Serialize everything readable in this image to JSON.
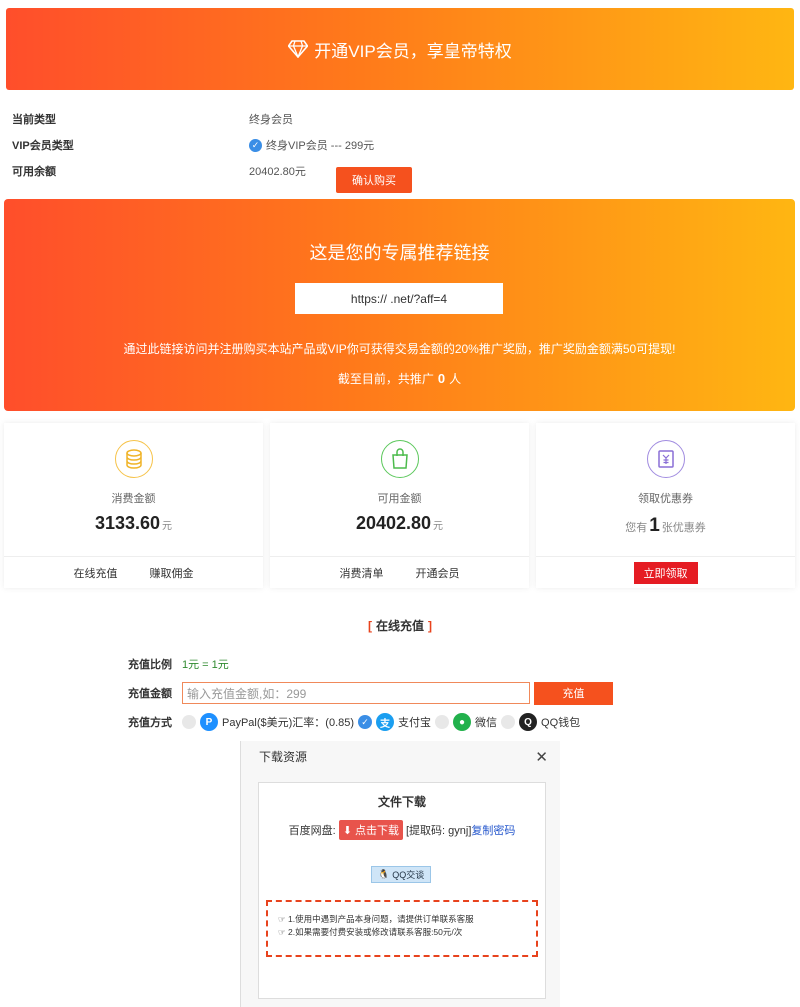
{
  "banner": {
    "title": "开通VIP会员，享皇帝特权"
  },
  "account": {
    "type_label": "当前类型",
    "type_value": "终身会员",
    "vip_label": "VIP会员类型",
    "vip_value": "终身VIP会员 --- 299元",
    "balance_label": "可用余额",
    "balance_value": "20402.80元",
    "buy_label": "确认购买"
  },
  "affiliate": {
    "title": "这是您的专属推荐链接",
    "link": "https://          .net/?aff=4",
    "desc": "通过此链接访问并注册购买本站产品或VIP你可获得交易金额的20%推广奖励，推广奖励金额满50可提现!",
    "count_prefix": "截至目前，共推广",
    "count": "0",
    "count_suffix": "人"
  },
  "cards": {
    "spent": {
      "label": "消费金额",
      "amount": "3133.60",
      "unit": "元",
      "action1": "在线充值",
      "action2": "赚取佣金"
    },
    "available": {
      "label": "可用金额",
      "amount": "20402.80",
      "unit": "元",
      "action1": "消费清单",
      "action2": "开通会员"
    },
    "coupon": {
      "label": "领取优惠券",
      "prefix": "您有",
      "count": "1",
      "suffix": "张优惠券",
      "action": "立即领取"
    }
  },
  "recharge": {
    "title": "在线充值",
    "bracket_l": "[",
    "bracket_r": "]",
    "ratio_label": "充值比例",
    "ratio_value": "1元 = 1元",
    "amount_label": "充值金额",
    "amount_placeholder": "输入充值金额,如：299",
    "submit_label": "充值",
    "method_label": "充值方式",
    "methods": [
      {
        "label": "PayPal($美元)汇率：(0.85)"
      },
      {
        "label": "支付宝"
      },
      {
        "label": "微信"
      },
      {
        "label": "QQ钱包"
      }
    ]
  },
  "download": {
    "dialog_title": "下载资源",
    "close": "✕",
    "file_title": "文件下载",
    "pan_label": "百度网盘:",
    "download_btn": "点击下载",
    "code_text": "[提取码: gynj]",
    "copy_label": "复制密码",
    "qq_label": "QQ交谈",
    "note1": "1.使用中遇到产品本身问题，请提供订单联系客服",
    "note2": "2.如果需要付费安装或修改请联系客服:50元/次"
  },
  "colors": {
    "accent": "#f5511e",
    "gradient_start": "#ff4e2b",
    "gradient_end": "#ffb612",
    "coupon_red": "#e51c23"
  }
}
